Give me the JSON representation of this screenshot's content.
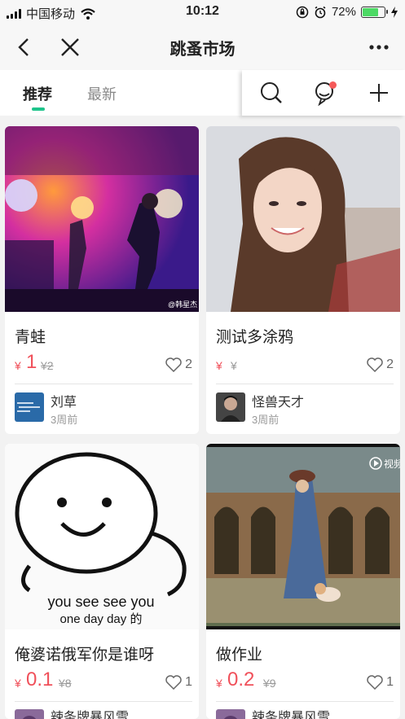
{
  "status_bar": {
    "carrier": "中国移动",
    "time": "10:12",
    "battery": "72%"
  },
  "nav": {
    "title": "跳蚤市场"
  },
  "tabs": [
    {
      "label": "推荐"
    },
    {
      "label": "最新"
    }
  ],
  "cards": [
    {
      "title": "青蛙",
      "currency": "¥",
      "price": "1",
      "old_price": "¥2",
      "likes": "2",
      "user": "刘草",
      "time": "3周前",
      "watermark": "@韩星杰"
    },
    {
      "title": "测试多涂鸦",
      "currency": "¥",
      "price": "",
      "old_price": "¥",
      "likes": "2",
      "user": "怪兽天才",
      "time": "3周前"
    },
    {
      "title": "俺婆诺俄军你是谁呀",
      "currency": "¥",
      "price": "0.1",
      "old_price": "¥8",
      "likes": "1",
      "user": "辣条牌暴风雪",
      "meme_line1": "you see see you",
      "meme_line2": "one day day 的"
    },
    {
      "title": "做作业",
      "currency": "¥",
      "price": "0.2",
      "old_price": "¥9",
      "likes": "1",
      "user": "辣条牌暴风雪",
      "video_label": "视频"
    }
  ],
  "colors": {
    "accent": "#1fc48b",
    "price": "#f0505a",
    "badge": "#f55a5a",
    "battery": "#4cd964"
  }
}
